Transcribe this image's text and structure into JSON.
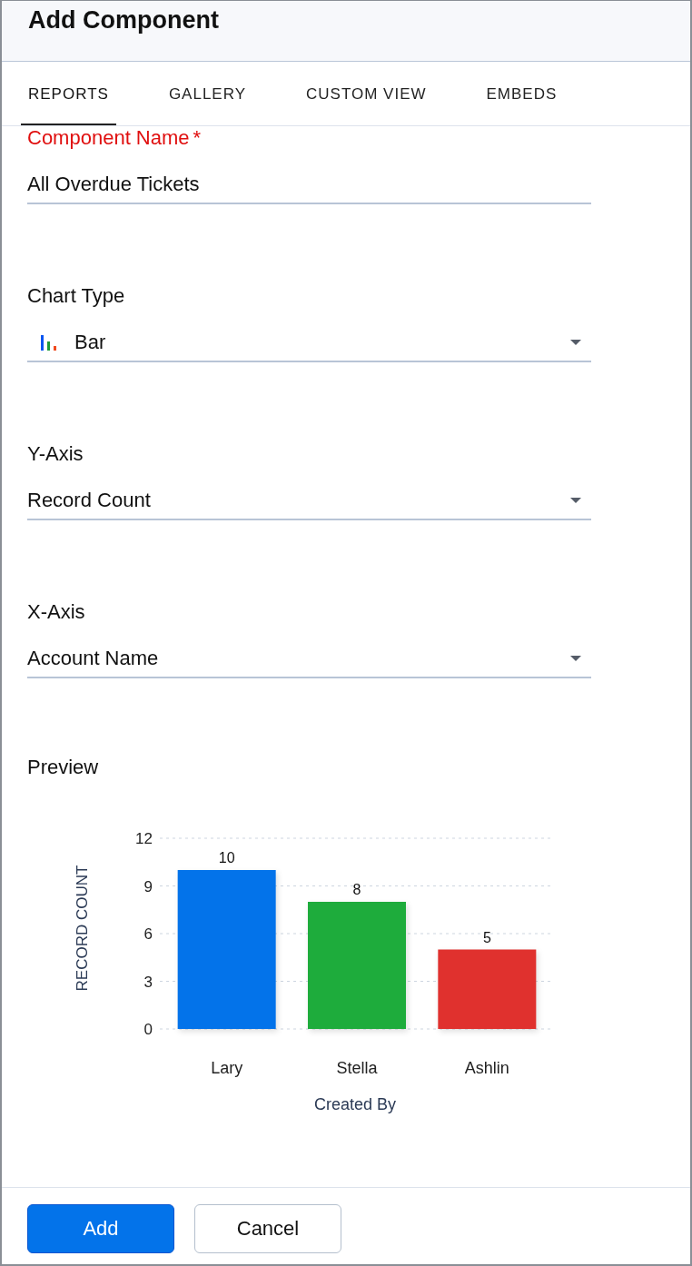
{
  "window": {
    "title": "Add Component"
  },
  "tabs": [
    {
      "label": "REPORTS",
      "selected": true
    },
    {
      "label": "GALLERY",
      "selected": false
    },
    {
      "label": "CUSTOM VIEW",
      "selected": false
    },
    {
      "label": "EMBEDS",
      "selected": false
    }
  ],
  "fields": [
    {
      "kind": "text",
      "label": "Component Name",
      "required": true,
      "required_mark": "*",
      "value": "All Overdue Tickets"
    },
    {
      "kind": "chart-select",
      "label": "Chart Type",
      "required": false,
      "value": "Bar"
    },
    {
      "kind": "select",
      "label": "Y-Axis",
      "required": false,
      "value": "Record Count"
    },
    {
      "kind": "select",
      "label": "X-Axis",
      "required": false,
      "value": "Account Name"
    }
  ],
  "preview": {
    "label": "Preview",
    "chart_data": {
      "type": "bar",
      "xlabel": "Created By",
      "ylabel": "RECORD COUNT",
      "categories": [
        "Lary",
        "Stella",
        "Ashlin"
      ],
      "values": [
        10,
        8,
        5
      ],
      "grid": true,
      "ylim": [
        0,
        12
      ],
      "yticks": [
        0,
        3,
        6,
        9,
        12
      ],
      "data_labels": true
    }
  },
  "buttons": [
    {
      "kind": "primary",
      "label": "Add"
    },
    {
      "kind": "secondary",
      "label": "Cancel"
    }
  ]
}
